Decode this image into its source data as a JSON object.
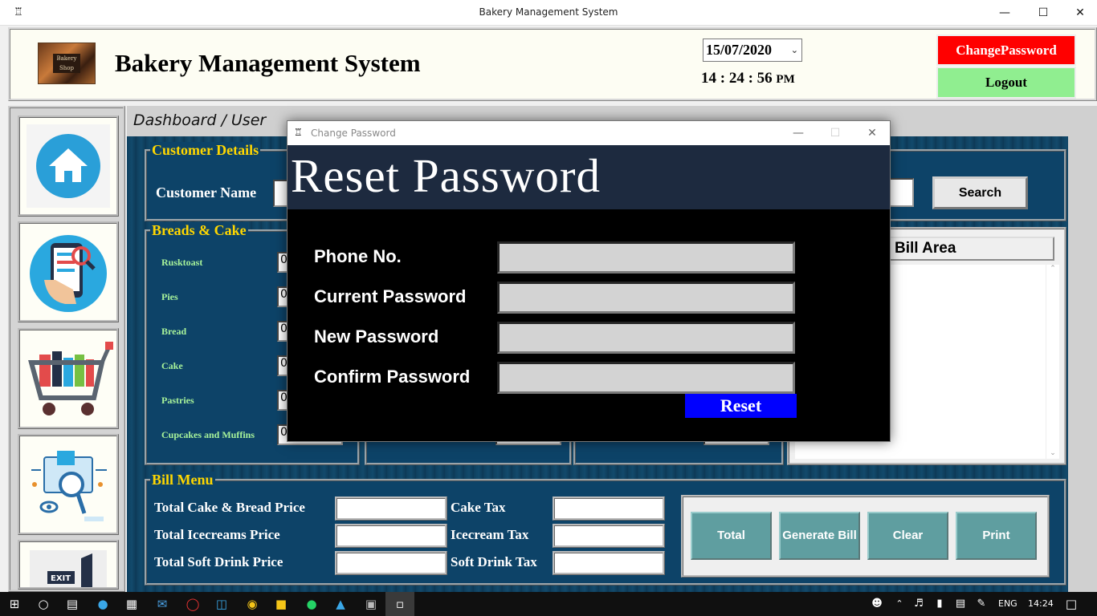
{
  "window": {
    "title": "Bakery Management System",
    "icon": "app-chef-icon"
  },
  "header": {
    "app_title": "Bakery Management System",
    "date_value": "15/07/2020",
    "time": "14 : 24 : 56",
    "time_suffix": "PM",
    "change_password_label": "ChangePassword",
    "logout_label": "Logout"
  },
  "sidebar": {
    "items": [
      {
        "name": "home",
        "icon": "home-icon"
      },
      {
        "name": "search-bill",
        "icon": "phone-search-icon"
      },
      {
        "name": "shop",
        "icon": "cart-icon"
      },
      {
        "name": "inventory",
        "icon": "inspect-icon"
      },
      {
        "name": "exit",
        "icon": "exit-icon",
        "label": "EXIT"
      }
    ]
  },
  "breadcrumb": "Dashboard / User",
  "customer": {
    "group_label": "Customer Details",
    "name_label": "Customer Name",
    "search_label": "Search"
  },
  "breads": {
    "group_label": "Breads & Cake",
    "items": [
      "Rusktoast",
      "Pies",
      "Bread",
      "Cake",
      "Pastries",
      "Cupcakes and Muffins"
    ],
    "qty_prefix": "0"
  },
  "bill_area": {
    "title": "Bill Area"
  },
  "bill_menu": {
    "group_label": "Bill Menu",
    "left_labels": [
      "Total Cake & Bread Price",
      "Total Icecreams Price",
      "Total Soft Drink Price"
    ],
    "right_labels": [
      "Cake Tax",
      "Icecream Tax",
      "Soft Drink Tax"
    ],
    "actions": [
      "Total",
      "Generate Bill",
      "Clear",
      "Print"
    ]
  },
  "dialog": {
    "title": "Change Password",
    "heading": "Reset Password",
    "fields": [
      "Phone No.",
      "Current Password",
      "New Password",
      "Confirm Password"
    ],
    "reset_label": "Reset"
  },
  "taskbar": {
    "lang": "ENG",
    "time": "14:24"
  },
  "colors": {
    "change_password_bg": "#ff0000",
    "logout_bg": "#90ee90",
    "reset_bg": "#0000ff",
    "group_label": "#ffd700",
    "action_btn": "#5f9ea0",
    "dialog_header": "#1d2a3f"
  }
}
